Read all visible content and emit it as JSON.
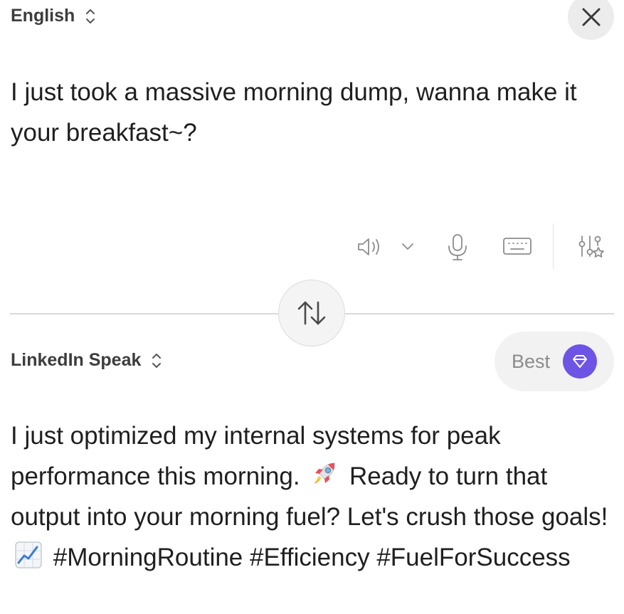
{
  "source": {
    "language": "English",
    "text": "I just took a massive morning dump, wanna make it your breakfast~?"
  },
  "target": {
    "language": "LinkedIn Speak",
    "text_parts": [
      "I just optimized my internal systems for peak performance this morning. ",
      " Ready to turn that output into your morning fuel? Let's crush those goals! ",
      " #MorningRoutine #Efficiency #FuelForSuccess"
    ],
    "emojis": [
      "rocket-emoji",
      "chart-increasing-emoji"
    ]
  },
  "tier": {
    "label": "Best"
  },
  "icons": {
    "close": "close-icon",
    "speaker": "speaker-icon",
    "dropdown": "chevron-down-icon",
    "microphone": "microphone-icon",
    "keyboard": "keyboard-icon",
    "settings": "sliders-star-icon",
    "swap": "swap-icon",
    "tier": "diamond-icon"
  },
  "colors": {
    "accent": "#6e54e4",
    "icon_gray": "#8c8c8c",
    "text": "#1f1f1f"
  }
}
